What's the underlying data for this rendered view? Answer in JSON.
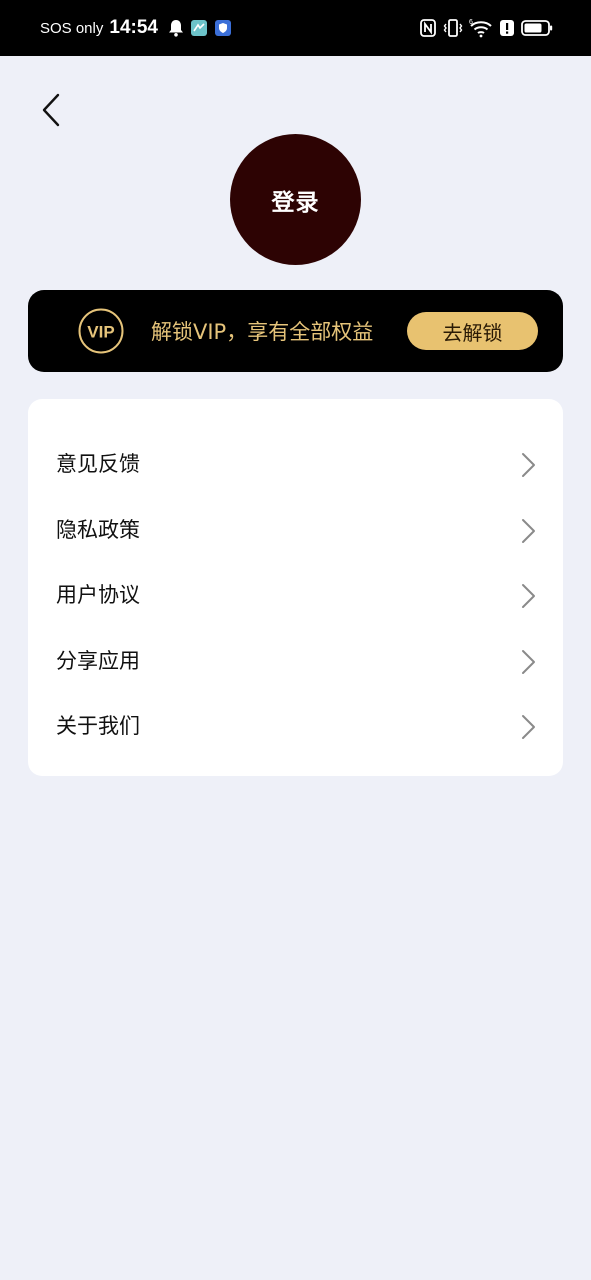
{
  "status_bar": {
    "carrier": "SOS only",
    "time": "14:54",
    "left_icons": [
      "bell-icon",
      "app-notification-icon",
      "shield-app-icon"
    ],
    "right_icons": [
      "nfc-icon",
      "vibrate-icon",
      "wifi-icon",
      "alert-icon",
      "battery-icon"
    ],
    "wifi_badge": "6"
  },
  "header": {
    "back_icon": "chevron-left-icon"
  },
  "profile": {
    "login_label": "登录",
    "avatar_color": "#2d0303"
  },
  "vip": {
    "badge_text": "VIP",
    "promo_text": "解锁VIP，享有全部权益",
    "unlock_label": "去解锁",
    "gold_color": "#e6c47a",
    "button_color": "#e8c270"
  },
  "menu": {
    "items": [
      {
        "label": "意见反馈",
        "icon": "chevron-right-icon"
      },
      {
        "label": "隐私政策",
        "icon": "chevron-right-icon"
      },
      {
        "label": "用户协议",
        "icon": "chevron-right-icon"
      },
      {
        "label": "分享应用",
        "icon": "chevron-right-icon"
      },
      {
        "label": "关于我们",
        "icon": "chevron-right-icon"
      }
    ]
  },
  "colors": {
    "background": "#eef0f8",
    "card": "#ffffff",
    "text": "#111111"
  }
}
